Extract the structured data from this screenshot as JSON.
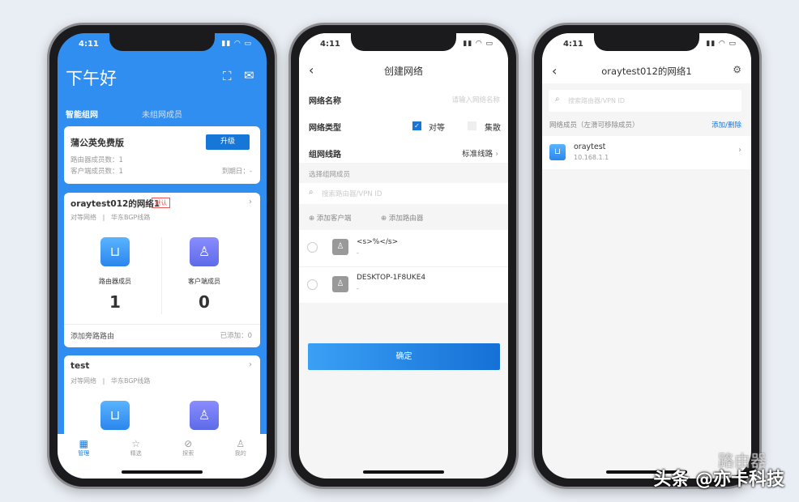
{
  "status_time": "4:11",
  "phone1": {
    "greeting": "下午好",
    "tabs": [
      "智能组网",
      "未组网成员"
    ],
    "plan": {
      "title": "蒲公英免费版",
      "upgrade": "升级",
      "router_count": "路由器成员数：1",
      "client_count": "客户端成员数：1",
      "expiry": "到期日：-"
    },
    "networks": [
      {
        "name": "oraytest012的网络1",
        "badge": "默认",
        "type": "对等网络",
        "sep": "|",
        "line": "华东BGP线路",
        "router_label": "路由器成员",
        "router_count": "1",
        "client_label": "客户端成员",
        "client_count": "0",
        "bypass": "添加旁路路由",
        "added": "已添加：0"
      },
      {
        "name": "test",
        "type": "对等网络",
        "sep": "|",
        "line": "华东BGP线路"
      }
    ],
    "tabbar": [
      "管理",
      "精选",
      "探索",
      "我的"
    ],
    "colors": {
      "primary": "#2f8ef0"
    }
  },
  "phone2": {
    "title": "创建网络",
    "name_label": "网络名称",
    "name_placeholder": "请输入网络名称",
    "type_label": "网络类型",
    "type_p2p": "对等",
    "type_p2p_checked": true,
    "type_central": "集散",
    "type_central_checked": false,
    "route_label": "组网线路",
    "route_value": "标准线路",
    "section": "选择组网成员",
    "search_placeholder": "搜索路由器/VPN ID",
    "add_client": "添加客户端",
    "add_router": "添加路由器",
    "members": [
      {
        "name": "<s>%</s>",
        "sub": "-"
      },
      {
        "name": "DESKTOP-1F8UKE4",
        "sub": "-"
      }
    ],
    "confirm": "确定"
  },
  "phone3": {
    "title": "oraytest012的网络1",
    "search_placeholder": "搜索路由器/VPN ID",
    "section": "网络成员（左滑可移除成员）",
    "action": "添加/删除",
    "members": [
      {
        "name": "oraytest",
        "ip": "10.168.1.1"
      }
    ]
  },
  "watermark": "头条 @亦卡科技",
  "watermark2": "路由器"
}
